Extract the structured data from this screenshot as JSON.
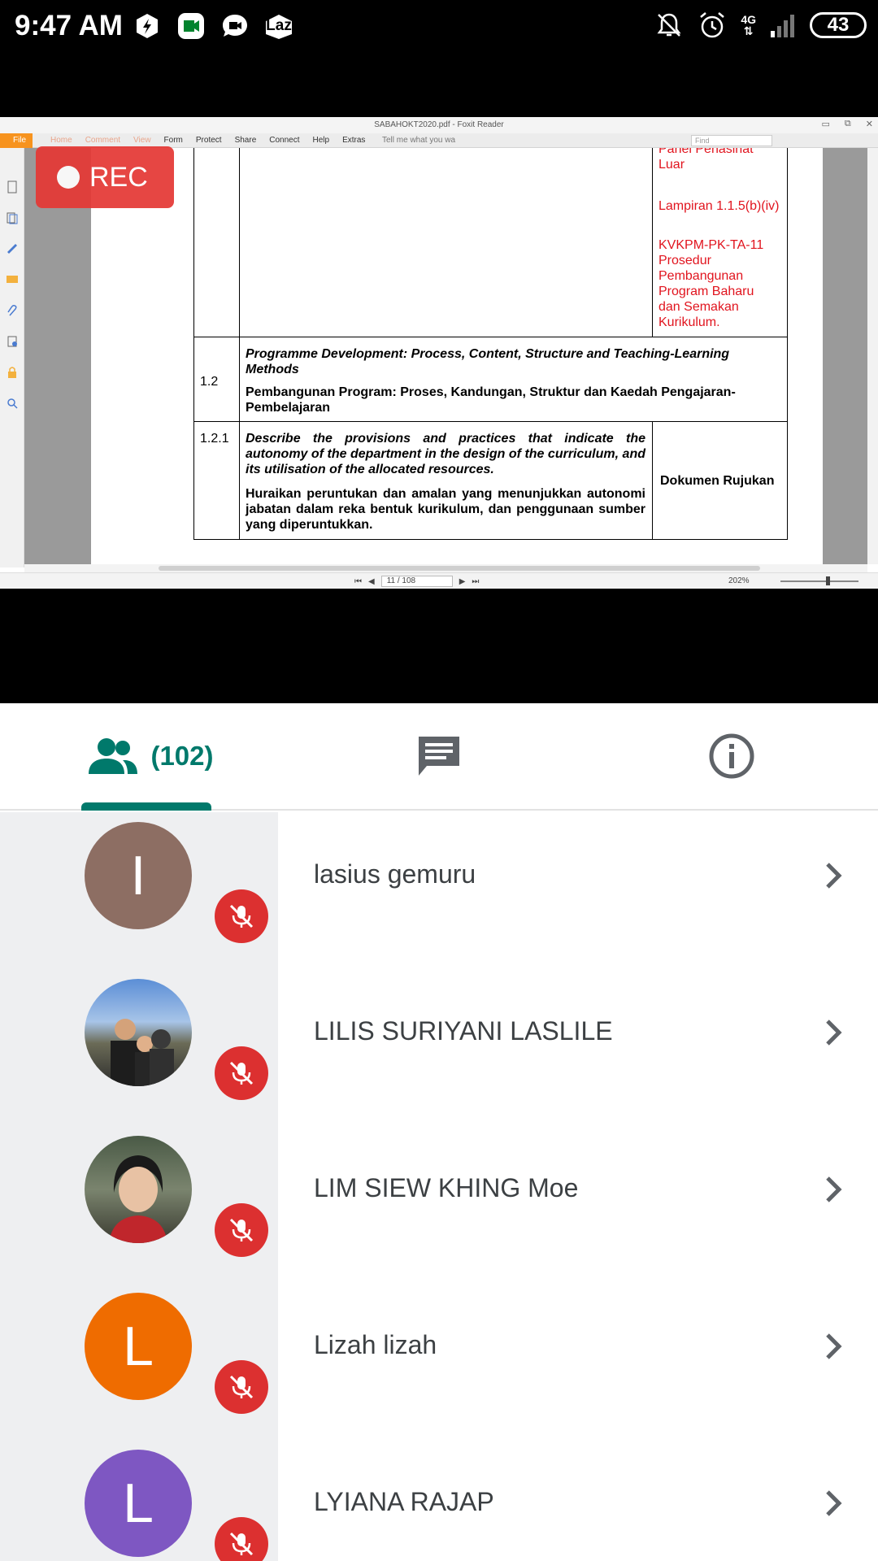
{
  "status_bar": {
    "time": "9:47 AM",
    "laz_label": "Laz",
    "network": "4G",
    "battery": "43",
    "icons": [
      "messenger-lightning-icon",
      "google-meet-icon",
      "chat-bubble-icon",
      "laz-icon",
      "bell-muted-icon",
      "alarm-clock-icon",
      "signal-icon"
    ]
  },
  "recording": {
    "label": "REC",
    "color": "#e53935"
  },
  "pdf": {
    "window_title": "SABAHOKT2020.pdf - Foxit Reader",
    "menu": [
      "File",
      "Home",
      "Comment",
      "View",
      "Form",
      "Protect",
      "Share",
      "Connect",
      "Help",
      "Extras"
    ],
    "tell_me": "Tell me what you wa",
    "find_placeholder": "Find",
    "page_indicator": "11 / 108",
    "zoom": "202%",
    "table": {
      "top_right_partial": "Panel Penasihat",
      "top_right_luar": "Luar",
      "lampiran": "Lampiran 1.1.5(b)(iv)",
      "kvkpm": "KVKPM-PK-TA-11 Prosedur Pembangunan Program Baharu dan Semakan Kurikulum.",
      "row_1_2_num": "1.2",
      "row_1_2_en": "Programme Development: Process, Content, Structure and Teaching-Learning Methods",
      "row_1_2_ms": "Pembangunan Program: Proses, Kandungan, Struktur dan Kaedah Pengajaran-Pembelajaran",
      "row_1_2_1_num": "1.2.1",
      "row_1_2_1_en": "Describe the provisions and practices that indicate the autonomy of the department in the design of the curriculum, and its utilisation of the allocated resources.",
      "row_1_2_1_ms": "Huraikan peruntukan dan amalan yang menunjukkan autonomi jabatan dalam reka bentuk kurikulum, dan penggunaan sumber yang diperuntukkan.",
      "row_1_2_1_ref": "Dokumen Rujukan"
    }
  },
  "tabs": {
    "people_count": "(102)",
    "accent": "#00796b"
  },
  "participants": [
    {
      "name": "lasius gemuru",
      "initial": "I",
      "avatar_color": "#8d6e63",
      "muted": true
    },
    {
      "name": "LILIS SURIYANI LASLILE",
      "initial": "",
      "avatar_color": "#6f8fb5",
      "muted": true
    },
    {
      "name": "LIM SIEW KHING Moe",
      "initial": "",
      "avatar_color": "#4c5a48",
      "muted": true
    },
    {
      "name": "Lizah lizah",
      "initial": "L",
      "avatar_color": "#ef6c00",
      "muted": true
    },
    {
      "name": "LYIANA RAJAP",
      "initial": "L",
      "avatar_color": "#7e57c2",
      "muted": true
    }
  ]
}
